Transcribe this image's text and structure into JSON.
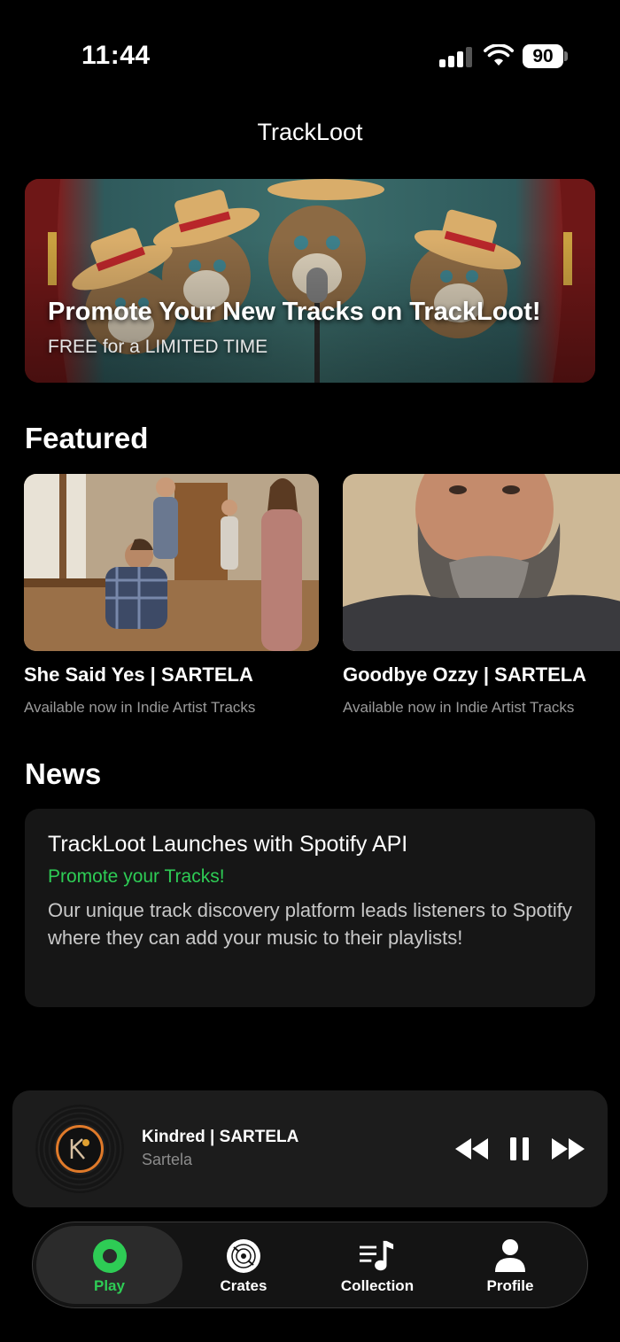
{
  "status_bar": {
    "time": "11:44",
    "battery": "90"
  },
  "app": {
    "title": "TrackLoot"
  },
  "banner": {
    "title": "Promote Your New Tracks on TrackLoot!",
    "subtitle": "FREE for a LIMITED TIME"
  },
  "featured": {
    "heading": "Featured",
    "items": [
      {
        "title": "She Said Yes | SARTELA",
        "subtitle": "Available now in Indie Artist Tracks"
      },
      {
        "title": "Goodbye Ozzy | SARTELA",
        "subtitle": "Available now in Indie Artist Tracks"
      }
    ]
  },
  "news": {
    "heading": "News",
    "items": [
      {
        "title": "TrackLoot Launches with Spotify API",
        "tag": "Promote your Tracks!",
        "body": "Our unique track discovery platform leads listeners to Spotify where they can add your music to their playlists!"
      }
    ]
  },
  "player": {
    "track": "Kindred | SARTELA",
    "artist": "Sartela",
    "icons": [
      "rewind-icon",
      "pause-icon",
      "fast-forward-icon"
    ]
  },
  "tabs": [
    {
      "label": "Play",
      "icon": "play-circle-icon",
      "active": true
    },
    {
      "label": "Crates",
      "icon": "disc-icon",
      "active": false
    },
    {
      "label": "Collection",
      "icon": "music-list-icon",
      "active": false
    },
    {
      "label": "Profile",
      "icon": "person-icon",
      "active": false
    }
  ],
  "colors": {
    "accent": "#2ecc55",
    "background": "#000000",
    "card": "#161616"
  }
}
